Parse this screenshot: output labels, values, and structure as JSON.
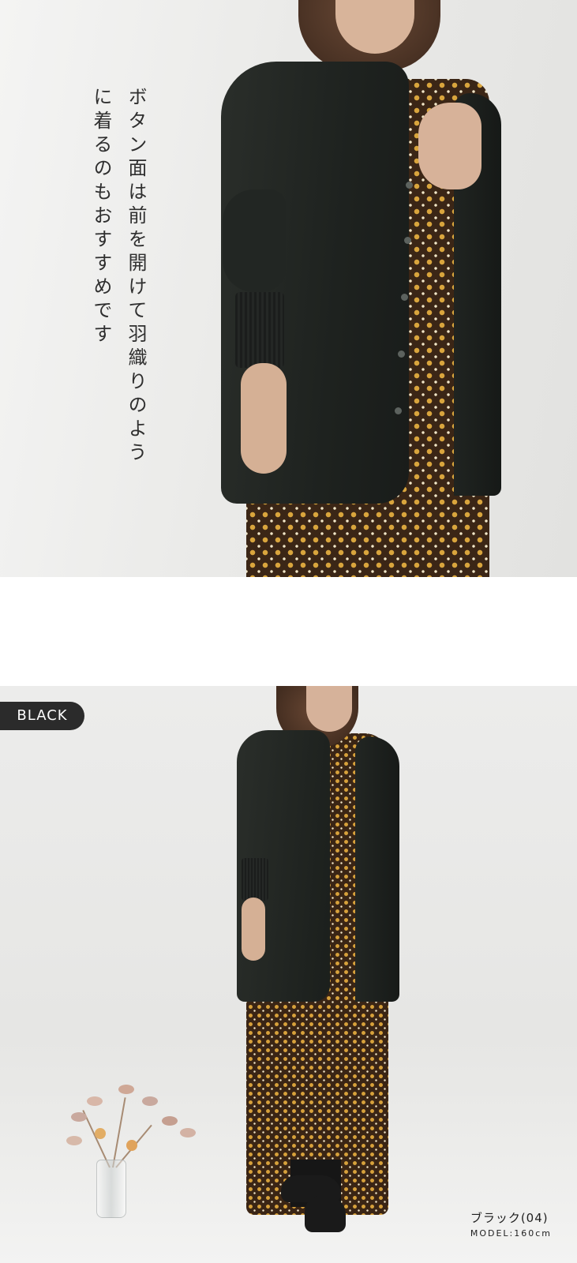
{
  "top_photo": {
    "caption": "ボタン面は前を開けて羽織りのように着るのもおすすめです"
  },
  "bottom_photo": {
    "color_tag": "BLACK",
    "color_name": "ブラック(04)",
    "model_height": "MODEL:160cm"
  }
}
